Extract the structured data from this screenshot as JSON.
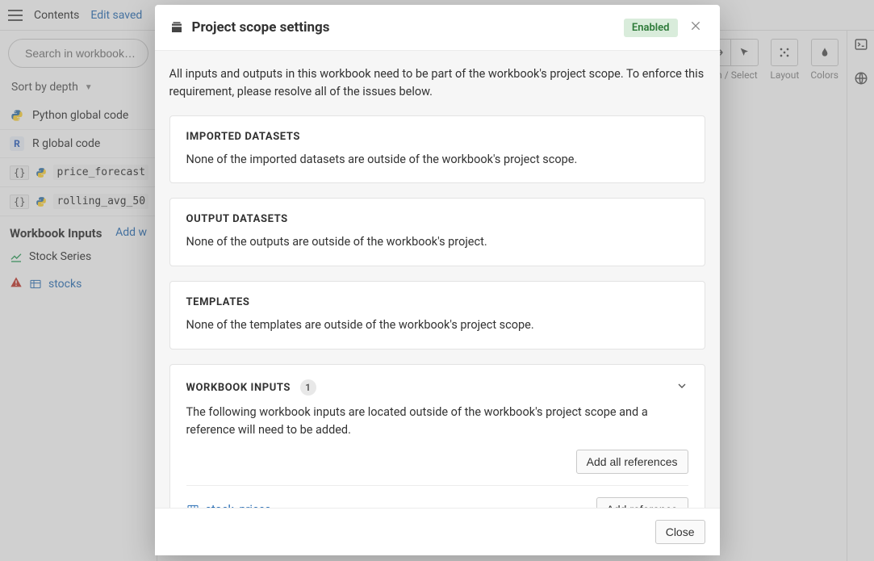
{
  "topbar": {
    "contents": "Contents",
    "edit_saved": "Edit saved"
  },
  "sidebar": {
    "search_placeholder": "Search in workbook…",
    "sort_label": "Sort by depth",
    "items": [
      {
        "label": "Python global code"
      },
      {
        "label": "R global code"
      },
      {
        "label": "price_forecast"
      },
      {
        "label": "rolling_avg_50"
      }
    ],
    "workbook_inputs_title": "Workbook Inputs",
    "add_link": "Add w",
    "inputs": [
      {
        "label": "Stock Series",
        "type": "chart"
      },
      {
        "label": "stocks",
        "type": "dataset",
        "warning": true
      }
    ]
  },
  "toolbar": {
    "pan_select": "Pan / Select",
    "layout": "Layout",
    "colors": "Colors"
  },
  "modal": {
    "title": "Project scope settings",
    "badge": "Enabled",
    "intro": "All inputs and outputs in this workbook need to be part of the workbook's project scope. To enforce this requirement, please resolve all of the issues below.",
    "sections": {
      "imported": {
        "title": "IMPORTED DATASETS",
        "text": "None of the imported datasets are outside of the workbook's project scope."
      },
      "output": {
        "title": "OUTPUT DATASETS",
        "text": "None of the outputs are outside of the workbook's project."
      },
      "templates": {
        "title": "TEMPLATES",
        "text": "None of the templates are outside of the workbook's project scope."
      },
      "workbook_inputs": {
        "title": "WORKBOOK INPUTS",
        "count": "1",
        "text": "The following workbook inputs are located outside of the workbook's project scope and a reference will need to be added.",
        "add_all": "Add all references",
        "items": [
          {
            "name": "stock_prices",
            "action": "Add reference"
          }
        ]
      }
    },
    "close": "Close"
  }
}
